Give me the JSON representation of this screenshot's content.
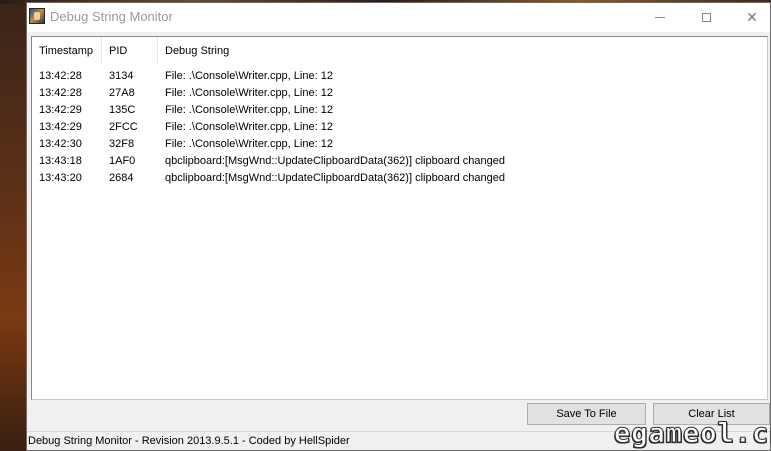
{
  "window": {
    "title": "Debug String Monitor"
  },
  "titlebar_buttons": {
    "minimize_icon": "minimize-icon",
    "maximize_icon": "maximize-icon",
    "close_icon": "close-icon",
    "close_glyph": "✕"
  },
  "list": {
    "columns": [
      "Timestamp",
      "PID",
      "Debug String"
    ],
    "rows": [
      {
        "timestamp": "13:42:28",
        "pid": "3134",
        "debug_string": "File: .\\Console\\Writer.cpp, Line: 12"
      },
      {
        "timestamp": "13:42:28",
        "pid": "27A8",
        "debug_string": "File: .\\Console\\Writer.cpp, Line: 12"
      },
      {
        "timestamp": "13:42:29",
        "pid": "135C",
        "debug_string": "File: .\\Console\\Writer.cpp, Line: 12"
      },
      {
        "timestamp": "13:42:29",
        "pid": "2FCC",
        "debug_string": "File: .\\Console\\Writer.cpp, Line: 12"
      },
      {
        "timestamp": "13:42:30",
        "pid": "32F8",
        "debug_string": "File: .\\Console\\Writer.cpp, Line: 12"
      },
      {
        "timestamp": "13:43:18",
        "pid": "1AF0",
        "debug_string": "qbclipboard:[MsgWnd::UpdateClipboardData(362)] clipboard changed"
      },
      {
        "timestamp": "13:43:20",
        "pid": "2684",
        "debug_string": "qbclipboard:[MsgWnd::UpdateClipboardData(362)] clipboard changed"
      }
    ]
  },
  "buttons": {
    "save_label": "Save To File",
    "clear_label": "Clear List"
  },
  "status": {
    "text": "Debug String Monitor  -  Revision 2013.9.5.1  -  Coded by HellSpider"
  },
  "watermark": {
    "text": "egameol.cn"
  },
  "colors": {
    "window_bg": "#ffffff",
    "client_bg": "#f0f0f0",
    "button_bg": "#e1e1e1",
    "title_text": "#9a9a9a"
  }
}
